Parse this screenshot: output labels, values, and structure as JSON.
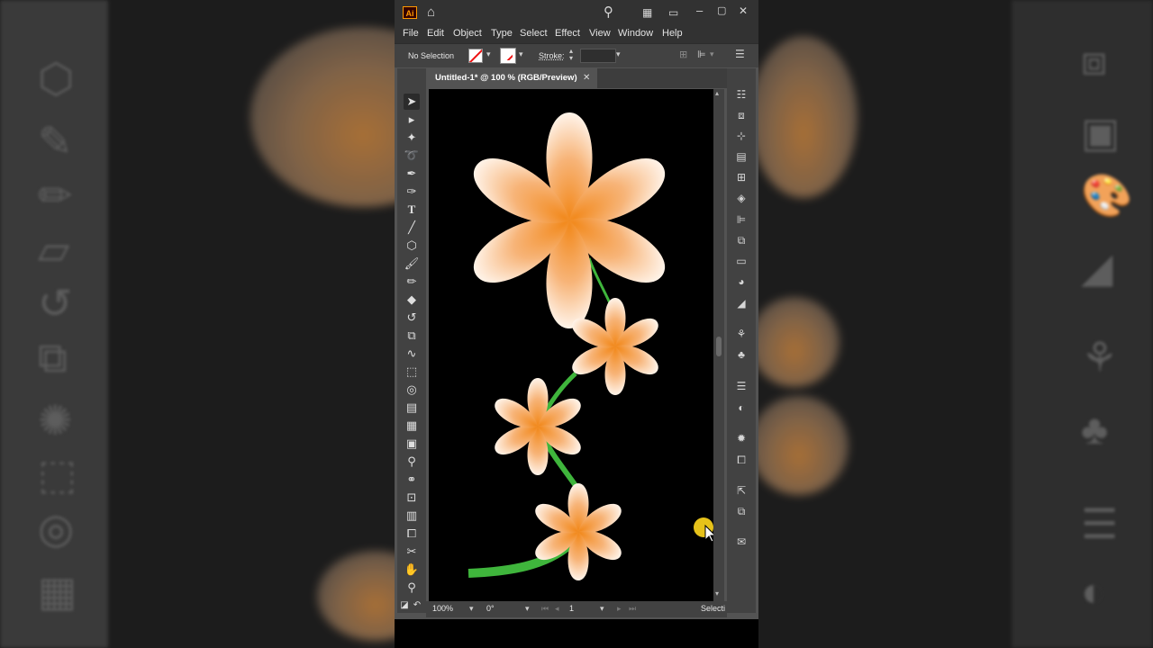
{
  "titlebar": {
    "app_logo": "Ai",
    "icons": [
      "home-icon",
      "search-icon",
      "arrange-documents-icon",
      "screen-mode-icon",
      "minimize-icon",
      "maximize-icon",
      "close-icon"
    ]
  },
  "menu": {
    "file": "File",
    "edit": "Edit",
    "object": "Object",
    "type": "Type",
    "select": "Select",
    "effect": "Effect",
    "view": "View",
    "window": "Window",
    "help": "Help"
  },
  "control_bar": {
    "selection_status": "No Selection",
    "stroke_label": "Stroke:",
    "stroke_value": ""
  },
  "document_tab": {
    "title": "Untitled-1* @ 100 % (RGB/Preview)",
    "close_glyph": "✕"
  },
  "status_bar": {
    "zoom": "100%",
    "rotation": "0°",
    "artboard": "1",
    "tool_status": "Selecti"
  },
  "colors": {
    "app_bg": "#535353",
    "panel_bg": "#424242",
    "titlebar_bg": "#323232",
    "petal_center": "#f28a1e",
    "petal_edge": "#fff4ea",
    "stem": "#3fb53c",
    "cursor_highlight": "#e6c21a"
  }
}
